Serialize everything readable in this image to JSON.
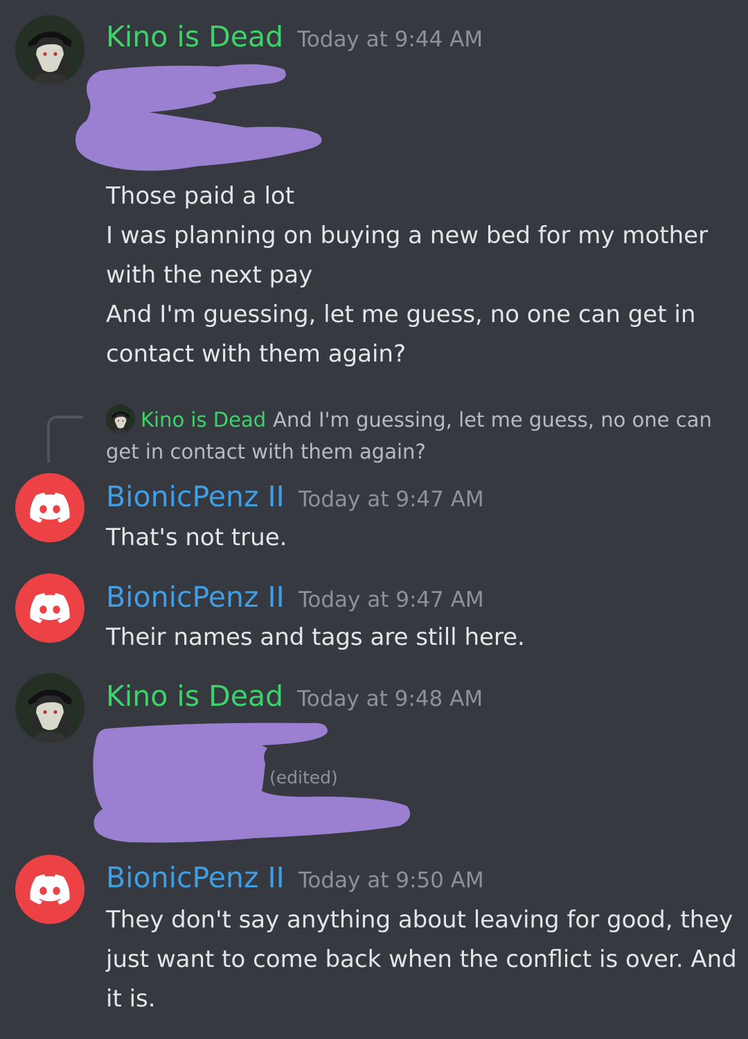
{
  "messages": [
    {
      "username": "Kino is Dead",
      "timestamp": "Today at 9:44 AM",
      "lines": [
        "Those paid a lot",
        "I was planning on buying a new bed for my mother",
        "with the next pay",
        "And I'm guessing, let me guess, no one can get in",
        "contact with them again?"
      ]
    },
    {
      "reply": {
        "username": "Kino is Dead",
        "text": "And I'm guessing, let me guess, no one can get in contact with them again?"
      },
      "username": "BionicPenz II",
      "timestamp": "Today at 9:47 AM",
      "lines": [
        "That's not true."
      ]
    },
    {
      "username": "BionicPenz II",
      "timestamp": "Today at 9:47 AM",
      "lines": [
        "Their names and tags are still here."
      ]
    },
    {
      "username": "Kino is Dead",
      "timestamp": "Today at 9:48 AM",
      "edited_label": "(edited)"
    },
    {
      "username": "BionicPenz II",
      "timestamp": "Today at 9:50 AM",
      "lines": [
        "They don't say anything about leaving for good, they",
        "just want to come back when the conflict is over. And",
        "it is."
      ]
    }
  ],
  "colors": {
    "background": "#36393f",
    "kino_username": "#3ed36a",
    "bionic_username": "#3f9ee4",
    "timestamp": "#8e9297",
    "redaction": "#9b7fd1",
    "discord_avatar": "#ed4245"
  },
  "icons": {
    "kino_avatar": "anime-character-avatar-icon",
    "bionic_avatar": "discord-logo-icon"
  }
}
